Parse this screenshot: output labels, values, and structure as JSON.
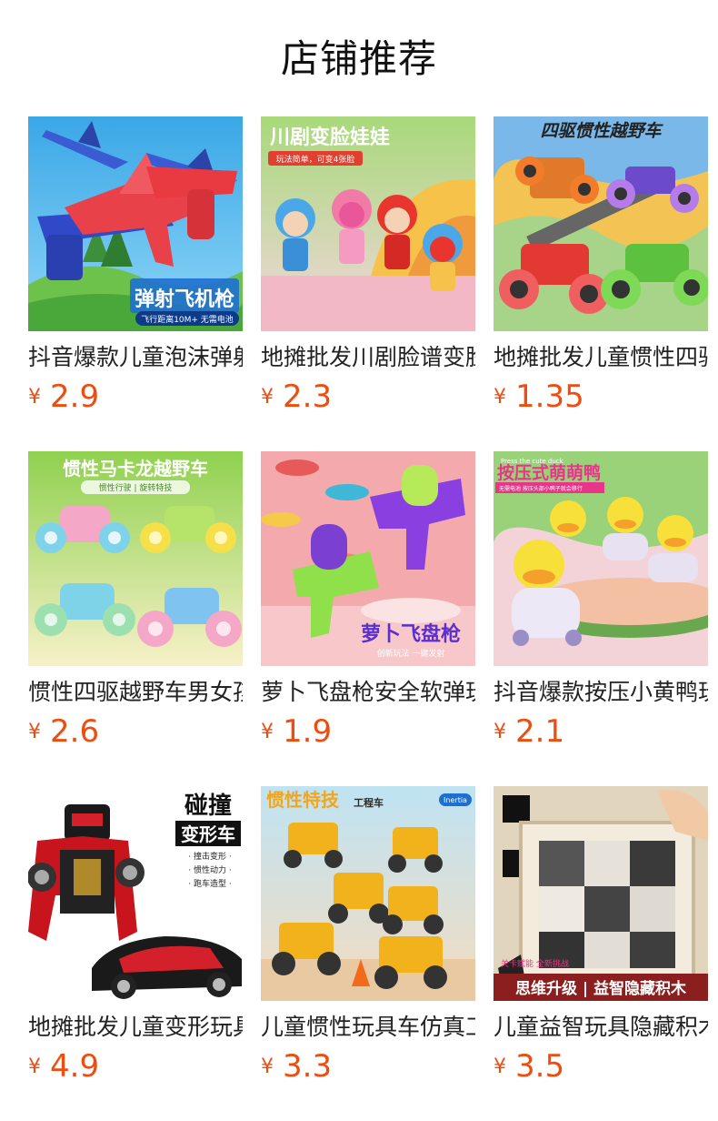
{
  "header": {
    "title": "店铺推荐"
  },
  "currency_symbol": "¥",
  "accent_color": "#ee4d10",
  "products": [
    {
      "name": "抖音爆款儿童泡沫弹射飞机枪",
      "price": "2.9",
      "image": {
        "label": "弹射飞机枪",
        "sub": "飞行距离10M+ 无需电池"
      }
    },
    {
      "name": "地摊批发川剧脸谱变脸娃娃",
      "price": "2.3",
      "image": {
        "label": "川剧变脸娃娃",
        "sub": "玩法简单，可变4张脸"
      }
    },
    {
      "name": "地摊批发儿童惯性四驱越野车",
      "price": "1.35",
      "image": {
        "label": "四驱惯性越野车"
      }
    },
    {
      "name": "惯性四驱越野车男女孩玩具",
      "price": "2.6",
      "image": {
        "label": "惯性马卡龙越野车",
        "sub": "惯性行驶 | 旋转特技"
      }
    },
    {
      "name": "萝卜飞盘枪安全软弹玩具",
      "price": "1.9",
      "image": {
        "label": "萝卜飞盘枪",
        "sub": "创新玩法 一键发射"
      }
    },
    {
      "name": "抖音爆款按压小黄鸭玩具",
      "price": "2.1",
      "image": {
        "label": "按压式萌萌鸭",
        "top": "Press the cute duck",
        "sub": "无需电池 按压头部小鸭子就会移行"
      }
    },
    {
      "name": "地摊批发儿童变形玩具车",
      "price": "4.9",
      "image": {
        "label": "碰撞",
        "label2": "变形车",
        "bullets": [
          "· 撞击变形 ·",
          "· 惯性动力 ·",
          "· 跑车造型 ·"
        ]
      }
    },
    {
      "name": "儿童惯性玩具车仿真工程车",
      "price": "3.3",
      "image": {
        "label": "惯性特技",
        "label_small": "工程车",
        "badge": "Inertia"
      }
    },
    {
      "name": "儿童益智玩具隐藏积木",
      "price": "3.5",
      "image": {
        "label": "思维升级 | 益智隐藏积木",
        "sub": "关卡赋能 全新挑战"
      }
    }
  ]
}
